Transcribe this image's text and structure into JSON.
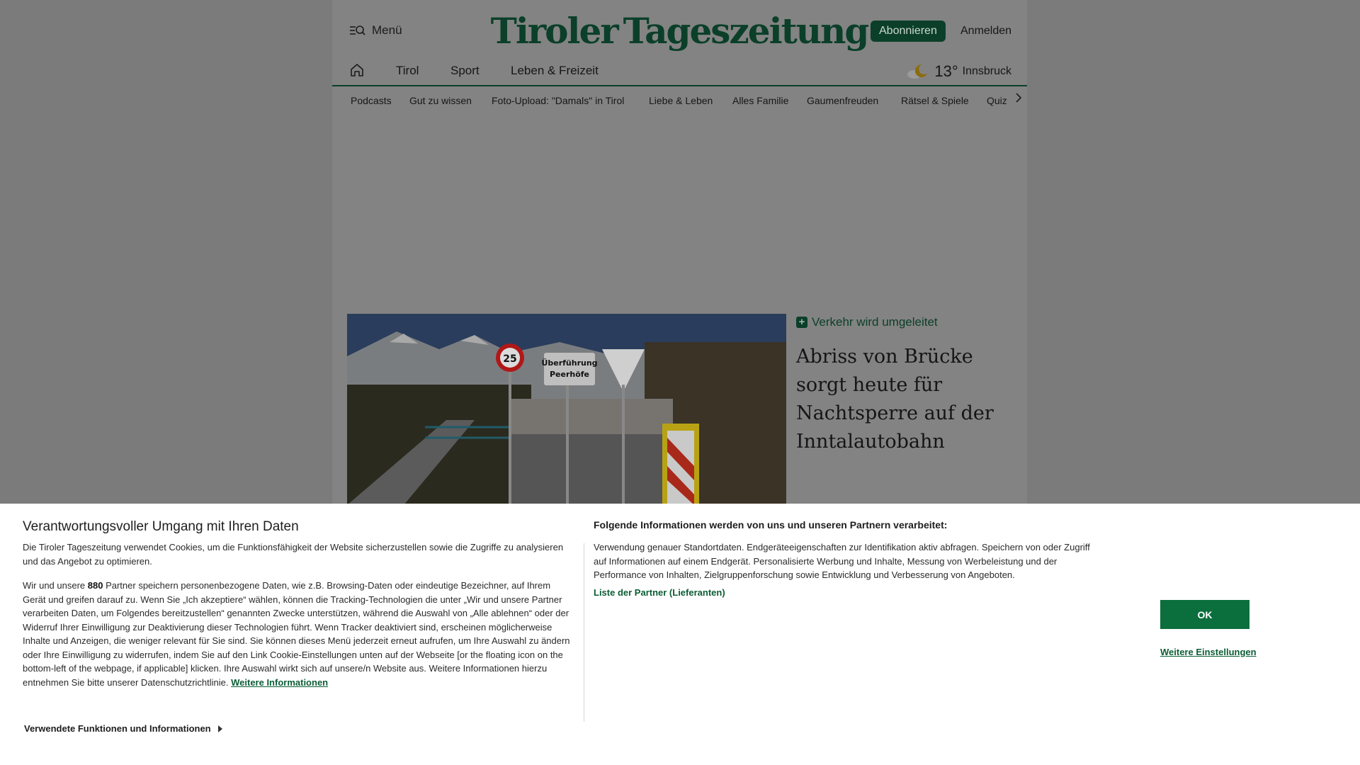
{
  "header": {
    "menu_label": "Menü",
    "logo_left": "Tiroler",
    "logo_right": "Tageszeitung",
    "subscribe_label": "Abonnieren",
    "login_label": "Anmelden"
  },
  "mainnav": {
    "items": [
      {
        "label": "Tirol"
      },
      {
        "label": "Sport"
      },
      {
        "label": "Leben & Freizeit"
      }
    ]
  },
  "weather": {
    "temp": "13°",
    "city": "Innsbruck",
    "icon": "moon-cloud-icon"
  },
  "subnav": {
    "items": [
      {
        "label": "Podcasts"
      },
      {
        "label": "Gut zu wissen"
      },
      {
        "label": "Foto-Upload: \"Damals\" in Tirol"
      },
      {
        "label": "Liebe & Leben"
      },
      {
        "label": "Alles Familie"
      },
      {
        "label": "Gaumenfreuden"
      },
      {
        "label": "Rätsel & Spiele"
      },
      {
        "label": "Quiz"
      }
    ]
  },
  "teaser": {
    "kicker": "Verkehr wird umgeleitet",
    "title": "Abriss von Brücke sorgt heute für Nachtsperre auf der Inntalautobahn",
    "sign_speed": "25",
    "sign_text_1": "Überführung",
    "sign_text_2": "Peerhöfe"
  },
  "consent": {
    "title": "Verantwortungsvoller Umgang mit Ihren Daten",
    "intro": "Die Tiroler Tageszeitung verwendet Cookies, um die Funktionsfähigkeit der Website sicherzustellen sowie die Zugriffe zu analysieren und das Angebot zu optimieren.",
    "partners_prefix": "Wir und unsere ",
    "partners_count": "880",
    "partners_body": " Partner speichern personenbezogene Daten, wie z.B. Browsing-Daten oder eindeutige Bezeichner, auf Ihrem Gerät und greifen darauf zu. Wenn Sie „Ich akzeptiere“ wählen, können die Tracking-Technologien die unter „Wir und unsere Partner verarbeiten Daten, um Folgendes bereitzustellen“ genannten Zwecke unterstützen, während die Auswahl von „Alle ablehnen“ oder der Widerruf Ihrer Einwilligung zur Deaktivierung dieser Technologien führt. Wenn Tracker deaktiviert sind, erscheinen möglicherweise Inhalte und Anzeigen, die weniger relevant für Sie sind. Sie können dieses Menü jederzeit erneut aufrufen, um Ihre Auswahl zu ändern oder Ihre Einwilligung zu widerrufen, indem Sie auf den Link Cookie-Einstellungen unten auf der Webseite [or the floating icon on the bottom-left of the webpage, if applicable] klicken. Ihre Auswahl wirkt sich auf unsere/n Website aus. Weitere Informationen hierzu entnehmen Sie bitte unserer Datenschutzrichtlinie. ",
    "more_info_link": "Weitere Informationen",
    "right_title": "Folgende Informationen werden von uns und unseren Partnern verarbeitet:",
    "right_body": "Verwendung genauer Standortdaten. Endgeräteeigenschaften zur Identifikation aktiv abfragen. Speichern von oder Zugriff auf Informationen auf einem Endgerät. Personalisierte Werbung und Inhalte, Messung von Werbeleistung und der Performance von Inhalten, Zielgruppenforschung sowie Entwicklung und Verbesserung von Angeboten.",
    "partners_link": "Liste der Partner (Lieferanten)",
    "ok_label": "OK",
    "more_settings_label": "Weitere Einstellungen",
    "functions_label": "Verwendete Funktionen und Informationen"
  },
  "colors": {
    "brand_green": "#0b3f29",
    "button_green": "#0b6e3d",
    "overlay": "#7b7b7b"
  }
}
